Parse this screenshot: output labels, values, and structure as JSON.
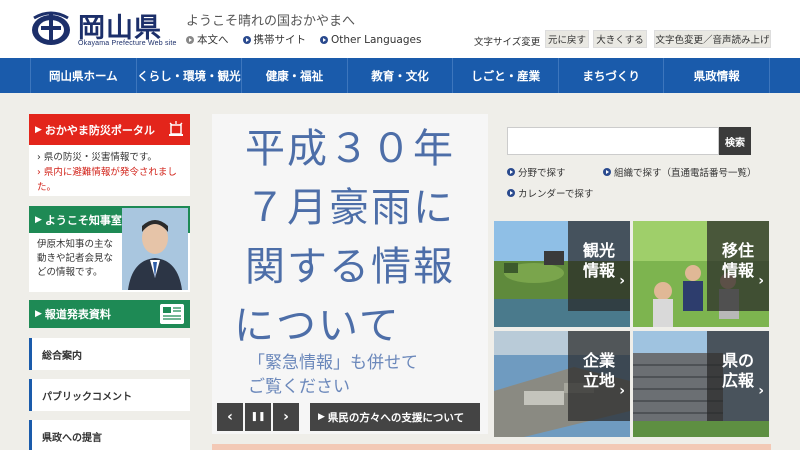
{
  "header": {
    "logo_title": "岡山県",
    "logo_sub": "Okayama Prefecture Web site",
    "tagline": "ようこそ晴れの国おかやまへ",
    "quicklinks": [
      "本文へ",
      "携帯サイト",
      "Other Languages"
    ],
    "textsize_label": "文字サイズ変更",
    "reset_label": "元に戻す",
    "enlarge_label": "大きくする",
    "color_voice_label": "文字色変更／音声読み上げ"
  },
  "nav": {
    "items": [
      "岡山県ホーム",
      "くらし・環境・観光",
      "健康・福祉",
      "教育・文化",
      "しごと・産業",
      "まちづくり",
      "県政情報"
    ]
  },
  "left": {
    "disaster_title": "おかやま防災ポータル",
    "disaster_line1": "県の防災・災害情報です。",
    "disaster_line2": "県内に避難情報が発令されました。",
    "governor_title": "ようこそ知事室へ",
    "governor_text": "伊原木知事の主な動きや記者会見などの情報です。",
    "press_title": "報道発表資料",
    "links": [
      "総合案内",
      "パブリックコメント",
      "県政への提言"
    ]
  },
  "slide": {
    "headline_lines": [
      "平成３０年",
      "７月豪雨に",
      "関する情報",
      "について"
    ],
    "note_line1": "「緊急情報」も併せて",
    "note_line2": "ご覧ください",
    "caption": "県民の方々への支援について",
    "prev_symbol": "‹",
    "pause_symbol": "❚❚",
    "next_symbol": "›"
  },
  "right": {
    "search_placeholder": "",
    "search_button": "検索",
    "link_field": "分野で探す",
    "link_org": "組織で探す（直通電話番号一覧）",
    "link_calendar": "カレンダーで探す",
    "tiles": [
      {
        "line1": "観光",
        "line2": "情報"
      },
      {
        "line1": "移住",
        "line2": "情報"
      },
      {
        "line1": "企業",
        "line2": "立地"
      },
      {
        "line1": "県の",
        "line2": "広報"
      }
    ]
  },
  "colors": {
    "nav_blue": "#1a5bab",
    "disaster_red": "#e3251b",
    "green": "#1e8a55",
    "slide_text": "#4d6ea8"
  }
}
